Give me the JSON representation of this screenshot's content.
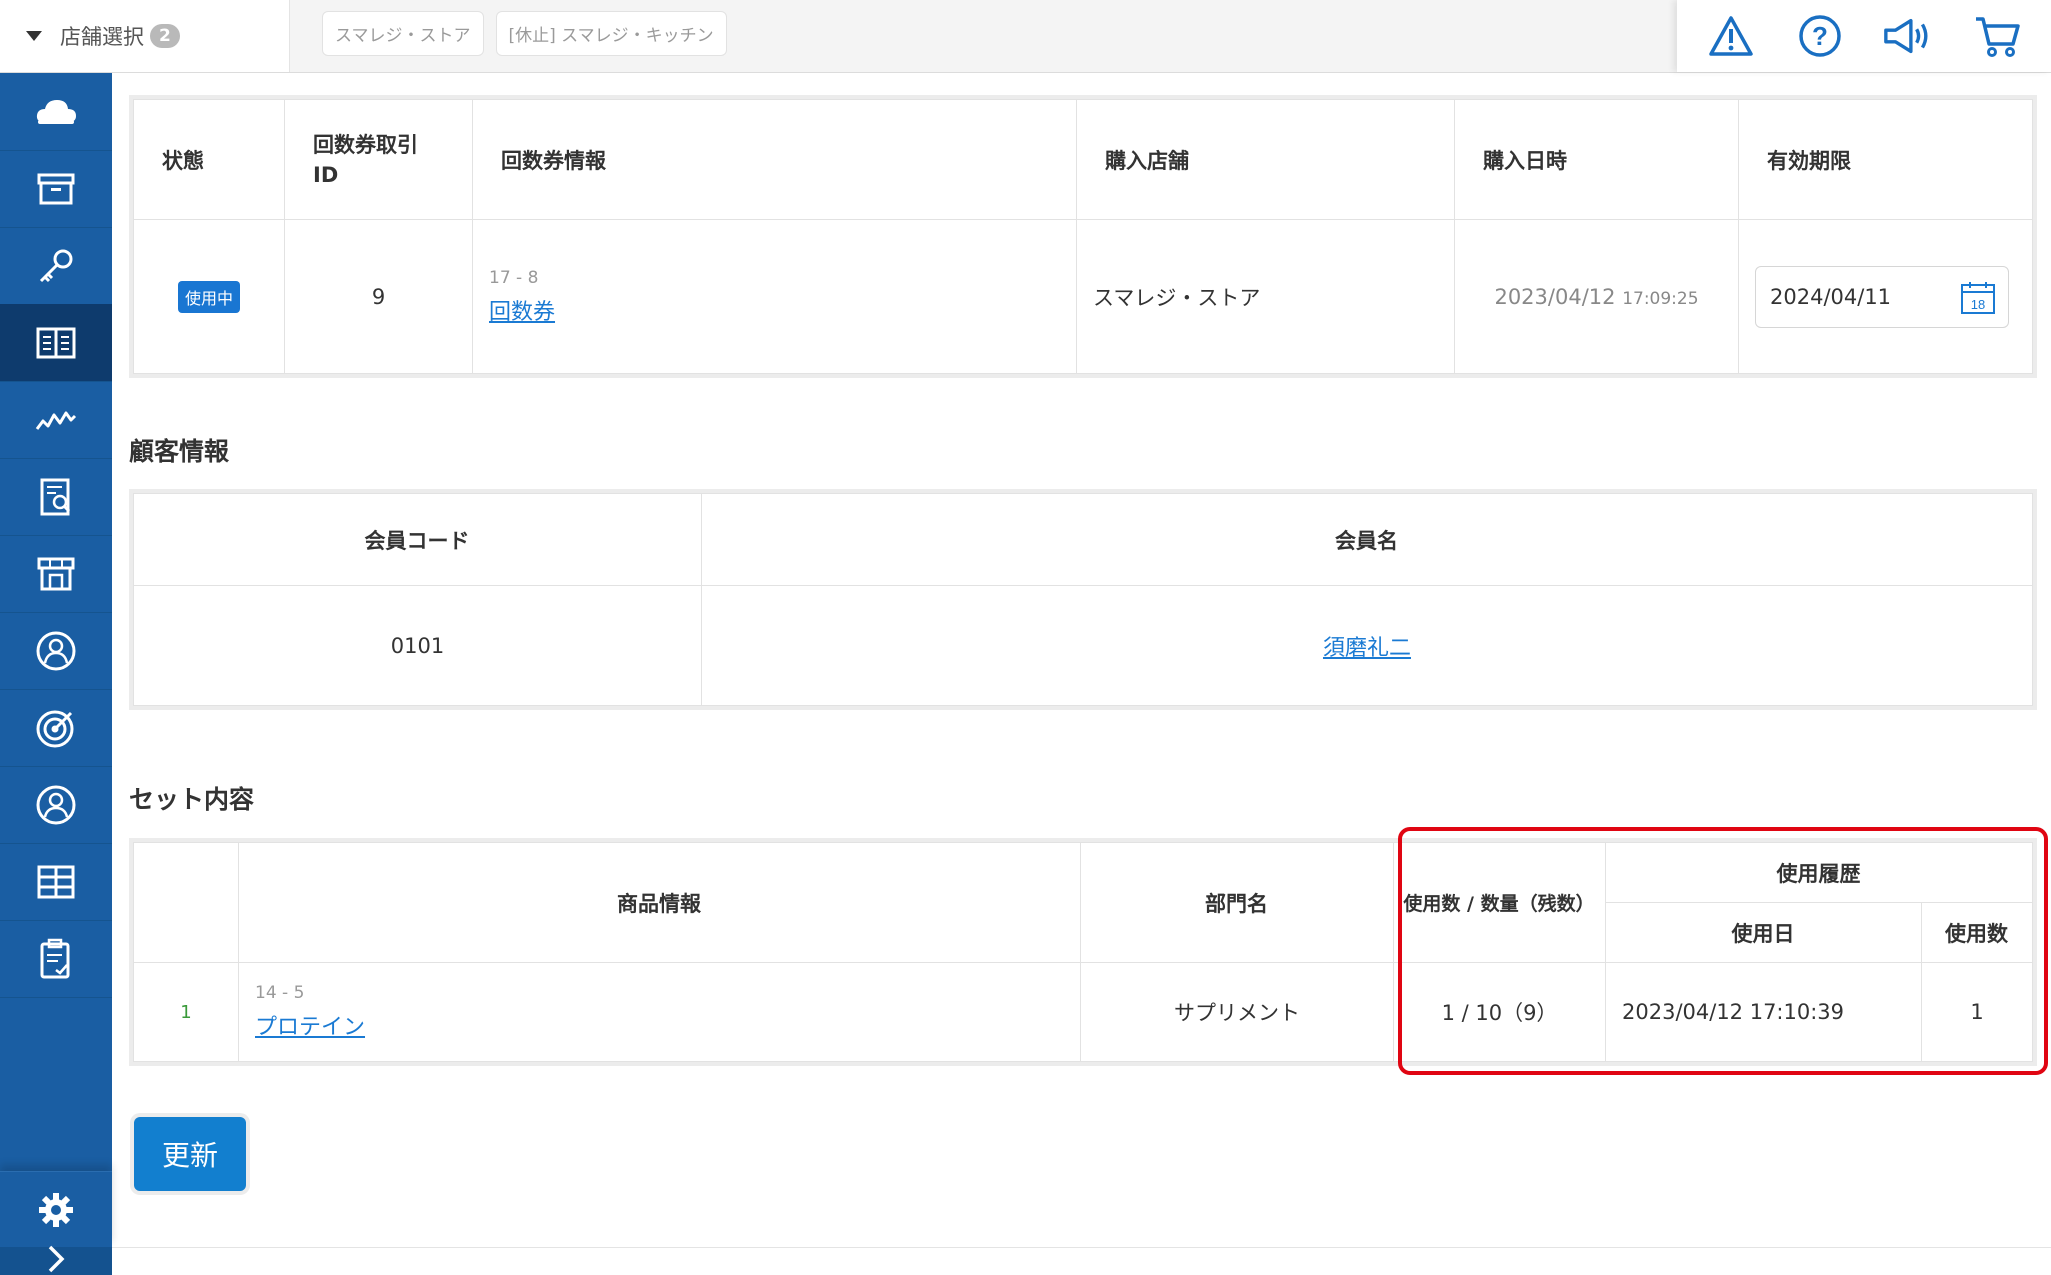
{
  "topbar": {
    "store_select_label": "店舗選択",
    "store_count": "2",
    "stores": [
      "スマレジ・ストア",
      "[休止] スマレジ・キッチン"
    ],
    "icons": [
      "warning-icon",
      "help-icon",
      "megaphone-icon",
      "cart-icon"
    ]
  },
  "sidebar": {
    "items": [
      "cloud-icon",
      "archive-icon",
      "key-icon",
      "book-icon",
      "chart-icon",
      "report-icon",
      "store-icon",
      "customer-icon",
      "target-icon",
      "user-icon",
      "grid-icon",
      "clipboard-icon"
    ],
    "active_index": 3,
    "bottom": [
      "gear-icon",
      "chevron-right-icon"
    ]
  },
  "ticket_table": {
    "headers": [
      "状態",
      "回数券取引\nID",
      "回数券情報",
      "購入店舗",
      "購入日時",
      "有効期限"
    ],
    "row": {
      "status": "使用中",
      "id": "9",
      "info_code": "17 - 8",
      "info_name": "回数券",
      "store": "スマレジ・ストア",
      "purchase_date": "2023/04/12",
      "purchase_time": "17:09:25",
      "expiry": "2024/04/11",
      "calendar_day": "18"
    }
  },
  "customer": {
    "title": "顧客情報",
    "headers": [
      "会員コード",
      "会員名"
    ],
    "code": "0101",
    "name": "須磨礼二"
  },
  "set_content": {
    "title": "セット内容",
    "headers": {
      "product": "商品情報",
      "dept": "部門名",
      "usage": "使用数 / 数量（残数）",
      "history": "使用履歴",
      "history_date": "使用日",
      "history_count": "使用数"
    },
    "rows": [
      {
        "no": "1",
        "code": "14 - 5",
        "name": "プロテイン",
        "dept": "サプリメント",
        "usage": "1 / 10（9）",
        "used_date": "2023/04/12 17:10:39",
        "used_count": "1"
      }
    ]
  },
  "actions": {
    "update_label": "更新"
  },
  "colors": {
    "sidebar": "#1a5ea3",
    "accent": "#127fcf",
    "highlight": "#e00512",
    "link": "#1a7ad3"
  }
}
